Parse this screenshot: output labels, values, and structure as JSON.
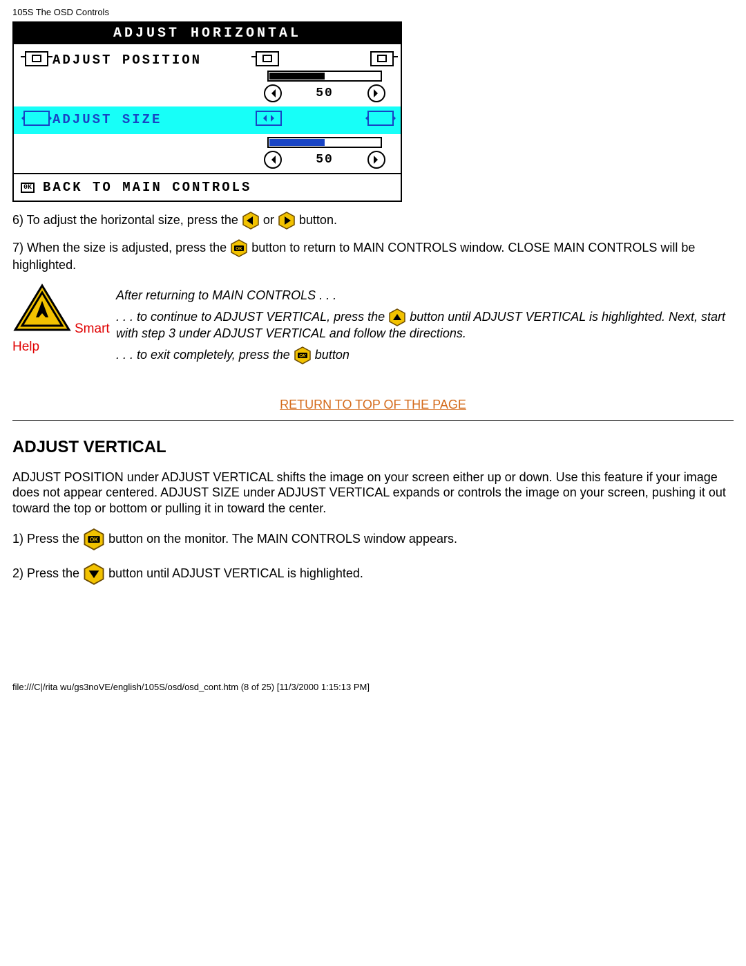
{
  "header": "105S The OSD Controls",
  "osd": {
    "title": "ADJUST HORIZONTAL",
    "rows": {
      "position": {
        "label": "ADJUST POSITION",
        "value": "50"
      },
      "size": {
        "label": "ADJUST SIZE",
        "value": "50"
      }
    },
    "footer": "BACK TO MAIN CONTROLS"
  },
  "step6": {
    "pre": "6) To adjust the horizontal size, press the ",
    "mid": " or ",
    "post": " button."
  },
  "step7": {
    "pre": "7) When the size is adjusted, press the ",
    "post": " button to return to MAIN CONTROLS window. CLOSE MAIN CONTROLS will be highlighted."
  },
  "smarthelp": {
    "label1": "Smart",
    "label2": "Help",
    "line1": "After returning to MAIN CONTROLS . . .",
    "line2_pre": ". . . to continue to ADJUST VERTICAL, press the ",
    "line2_post": " button until ADJUST VERTICAL is highlighted. Next, start with step 3 under ADJUST VERTICAL and follow the directions.",
    "line3_pre": ". . . to exit completely, press the ",
    "line3_post": " button"
  },
  "return_link": "RETURN TO TOP OF THE PAGE",
  "section2": {
    "heading": "ADJUST VERTICAL",
    "desc": "ADJUST POSITION under ADJUST VERTICAL shifts the image on your screen either up or down. Use this feature if your image does not appear centered. ADJUST SIZE under ADJUST VERTICAL expands or controls the image on your screen, pushing it out toward the top or bottom or pulling it in toward the center.",
    "step1_pre": "1) Press the ",
    "step1_post": " button on the monitor. The MAIN CONTROLS window appears.",
    "step2_pre": "2) Press the ",
    "step2_post": " button until ADJUST VERTICAL is highlighted."
  },
  "footer_path": "file:///C|/rita wu/gs3noVE/english/105S/osd/osd_cont.htm (8 of 25) [11/3/2000 1:15:13 PM]"
}
